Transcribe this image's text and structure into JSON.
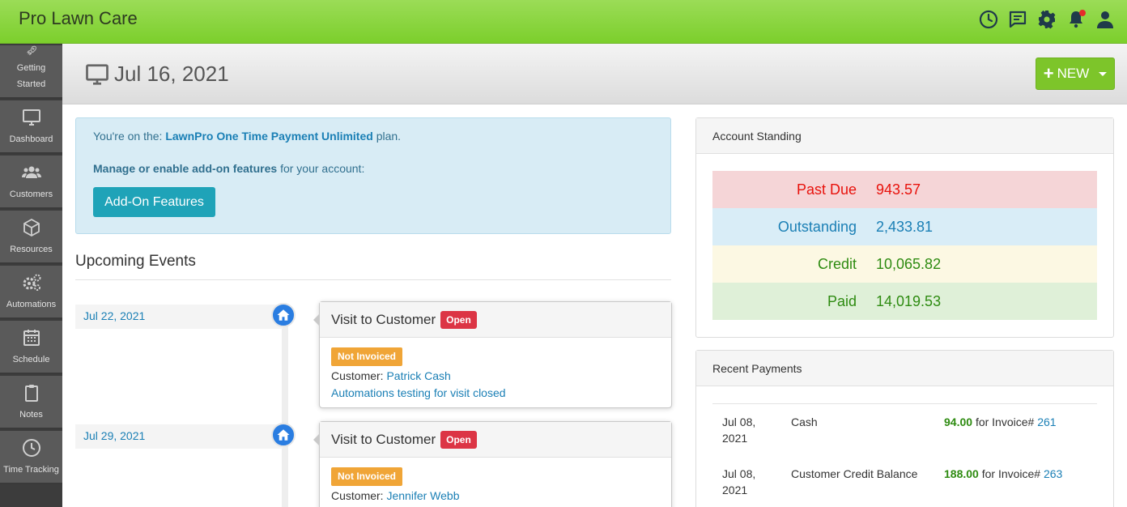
{
  "app": {
    "title": "Pro Lawn Care"
  },
  "topbar": {
    "icons": [
      "clock-icon",
      "chat-icon",
      "gear-icon",
      "bell-icon",
      "user-icon"
    ],
    "notification_color": "#e52b2b"
  },
  "sidebar": {
    "items": [
      {
        "label1": "Getting",
        "label2": "Started",
        "icon": "rocket-icon"
      },
      {
        "label": "Dashboard",
        "icon": "monitor-icon"
      },
      {
        "label": "Customers",
        "icon": "users-icon"
      },
      {
        "label": "Resources",
        "icon": "cube-icon"
      },
      {
        "label": "Automations",
        "icon": "cogs-icon"
      },
      {
        "label": "Schedule",
        "icon": "calendar-icon"
      },
      {
        "label": "Notes",
        "icon": "clipboard-icon"
      },
      {
        "label": "Time Tracking",
        "icon": "clock-icon"
      }
    ]
  },
  "header": {
    "date": "Jul 16, 2021",
    "new_label": "NEW",
    "accent": "#7dc52a"
  },
  "alert": {
    "prefix": "You're on the:",
    "plan": "LawnPro One Time Payment Unlimited",
    "suffix": "plan.",
    "manage_bold": "Manage or enable add-on features",
    "manage_rest": "for your account:",
    "button": "Add-On Features"
  },
  "events": {
    "title": "Upcoming Events",
    "items": [
      {
        "date": "Jul 22, 2021",
        "title": "Visit to Customer",
        "status": "Open",
        "invoice_status": "Not Invoiced",
        "customer_label": "Customer:",
        "customer": "Patrick Cash",
        "note": "Automations testing for visit closed"
      },
      {
        "date": "Jul 29, 2021",
        "title": "Visit to Customer",
        "status": "Open",
        "invoice_status": "Not Invoiced",
        "customer_label": "Customer:",
        "customer": "Jennifer Webb"
      }
    ]
  },
  "account_standing": {
    "title": "Account Standing",
    "rows": [
      {
        "label": "Past Due",
        "value": "943.57",
        "bg": "#f5d5d7",
        "color": "#e8120c"
      },
      {
        "label": "Outstanding",
        "value": "2,433.81",
        "bg": "#d9edf7",
        "color": "#1a7fb5"
      },
      {
        "label": "Credit",
        "value": "10,065.82",
        "bg": "#fcf8e3",
        "color": "#2e8b11"
      },
      {
        "label": "Paid",
        "value": "14,019.53",
        "bg": "#dff0d8",
        "color": "#2e8b11"
      }
    ]
  },
  "recent_payments": {
    "title": "Recent Payments",
    "rows": [
      {
        "date1": "Jul 08,",
        "date2": "2021",
        "method": "Cash",
        "amount": "94.00",
        "for_text": "for Invoice#",
        "invoice": "261"
      },
      {
        "date1": "Jul 08,",
        "date2": "2021",
        "method": "Customer Credit Balance",
        "amount": "188.00",
        "for_text": "for Invoice#",
        "invoice": "263"
      }
    ]
  }
}
